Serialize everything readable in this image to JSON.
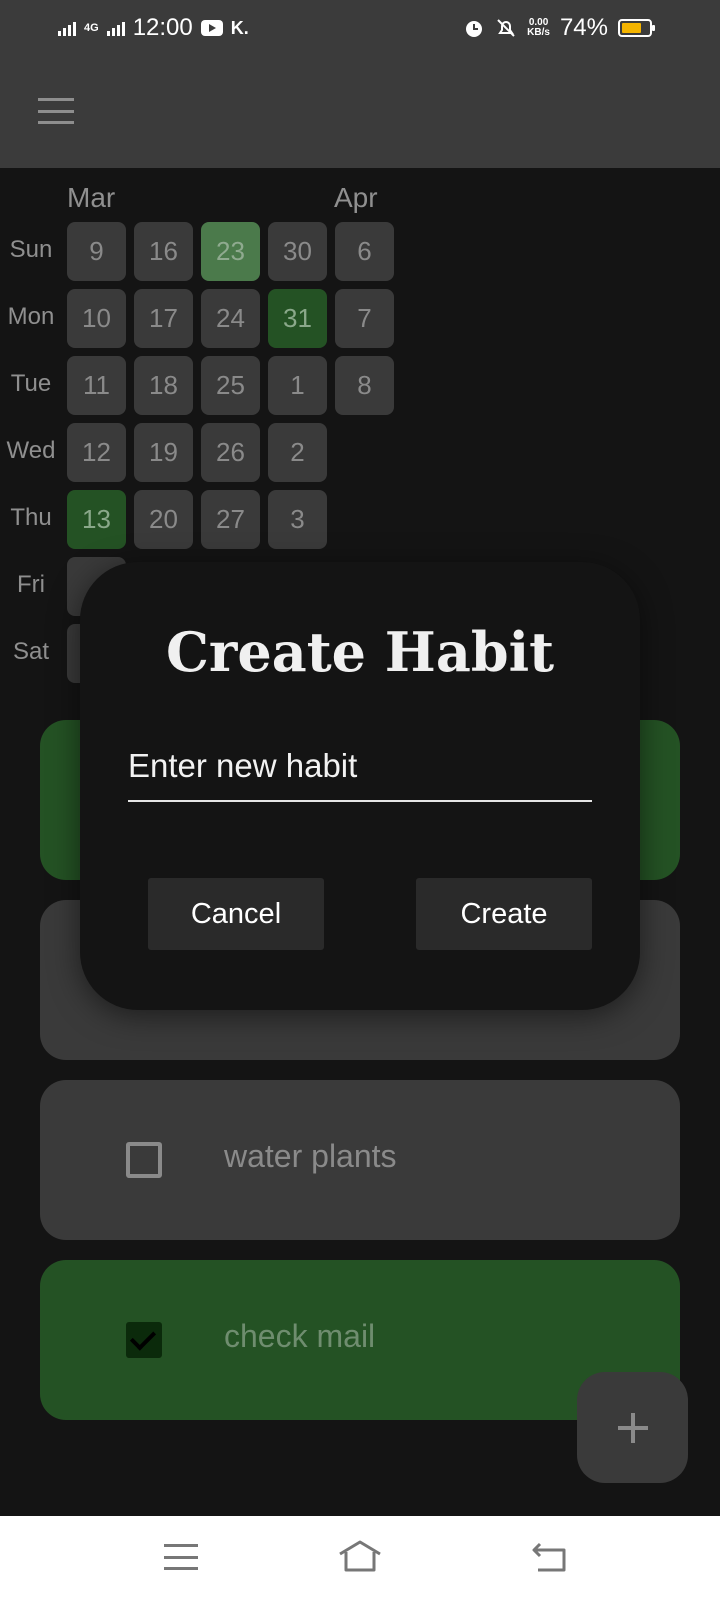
{
  "status_bar": {
    "time": "12:00",
    "network": "4G",
    "carrier_icon_text": "K.",
    "data_speed_value": "0.00",
    "data_speed_unit": "KB/s",
    "battery_percent": "74%",
    "battery_level": 0.74,
    "battery_color": "#f4b400"
  },
  "app_bar": {
    "menu_icon": "hamburger-menu-icon"
  },
  "heatmap": {
    "months": [
      "Mar",
      "Apr"
    ],
    "days": [
      "Sun",
      "Mon",
      "Tue",
      "Wed",
      "Thu",
      "Fri",
      "Sat"
    ],
    "columns": [
      [
        "9",
        "10",
        "11",
        "12",
        "13",
        "",
        ""
      ],
      [
        "16",
        "17",
        "18",
        "19",
        "20",
        "",
        ""
      ],
      [
        "23",
        "24",
        "25",
        "26",
        "27",
        "",
        ""
      ],
      [
        "30",
        "31",
        "1",
        "2",
        "3",
        "",
        ""
      ],
      [
        "6",
        "7",
        "8",
        "",
        "",
        "",
        ""
      ]
    ],
    "completed": [
      "13",
      "31"
    ],
    "today": "23"
  },
  "habits": [
    {
      "label": "",
      "checked": true
    },
    {
      "label": "",
      "checked": false
    },
    {
      "label": "water plants",
      "checked": false
    },
    {
      "label": "check mail",
      "checked": true
    }
  ],
  "fab": {
    "icon": "plus-icon"
  },
  "dialog": {
    "title": "Create Habit",
    "input_placeholder": "Enter new habit",
    "input_value": "",
    "cancel_label": "Cancel",
    "create_label": "Create"
  },
  "nav_bar": {
    "icons": [
      "menu-icon",
      "home-icon",
      "back-icon"
    ]
  },
  "colors": {
    "background": "#141414",
    "surface": "#3a3a3a",
    "completed_green": "#245224",
    "today_green": "#4b7a4b"
  }
}
